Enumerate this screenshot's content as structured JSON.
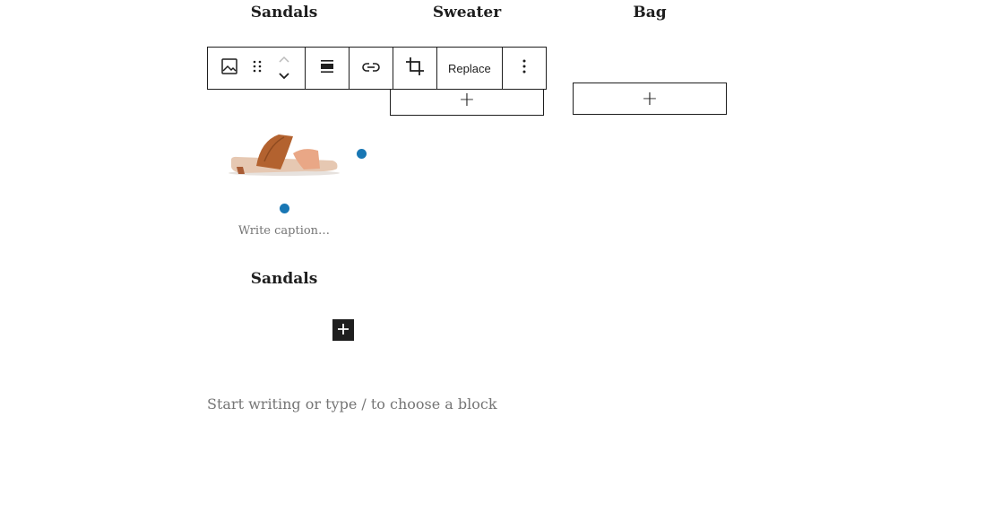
{
  "columns": [
    {
      "heading": "Sandals"
    },
    {
      "heading": "Sweater"
    },
    {
      "heading": "Bag"
    }
  ],
  "appender_symbol": "+",
  "toolbar": {
    "replace_label": "Replace",
    "icons": [
      "image-icon",
      "drag-handle-icon",
      "move-up-icon",
      "move-down-icon",
      "align-icon",
      "link-icon",
      "crop-icon",
      "more-options-icon"
    ]
  },
  "image": {
    "caption_placeholder": "Write caption…",
    "heading_below": "Sandals",
    "handle_color": "#1977b4"
  },
  "editor": {
    "placeholder": "Start writing or type / to choose a block"
  }
}
